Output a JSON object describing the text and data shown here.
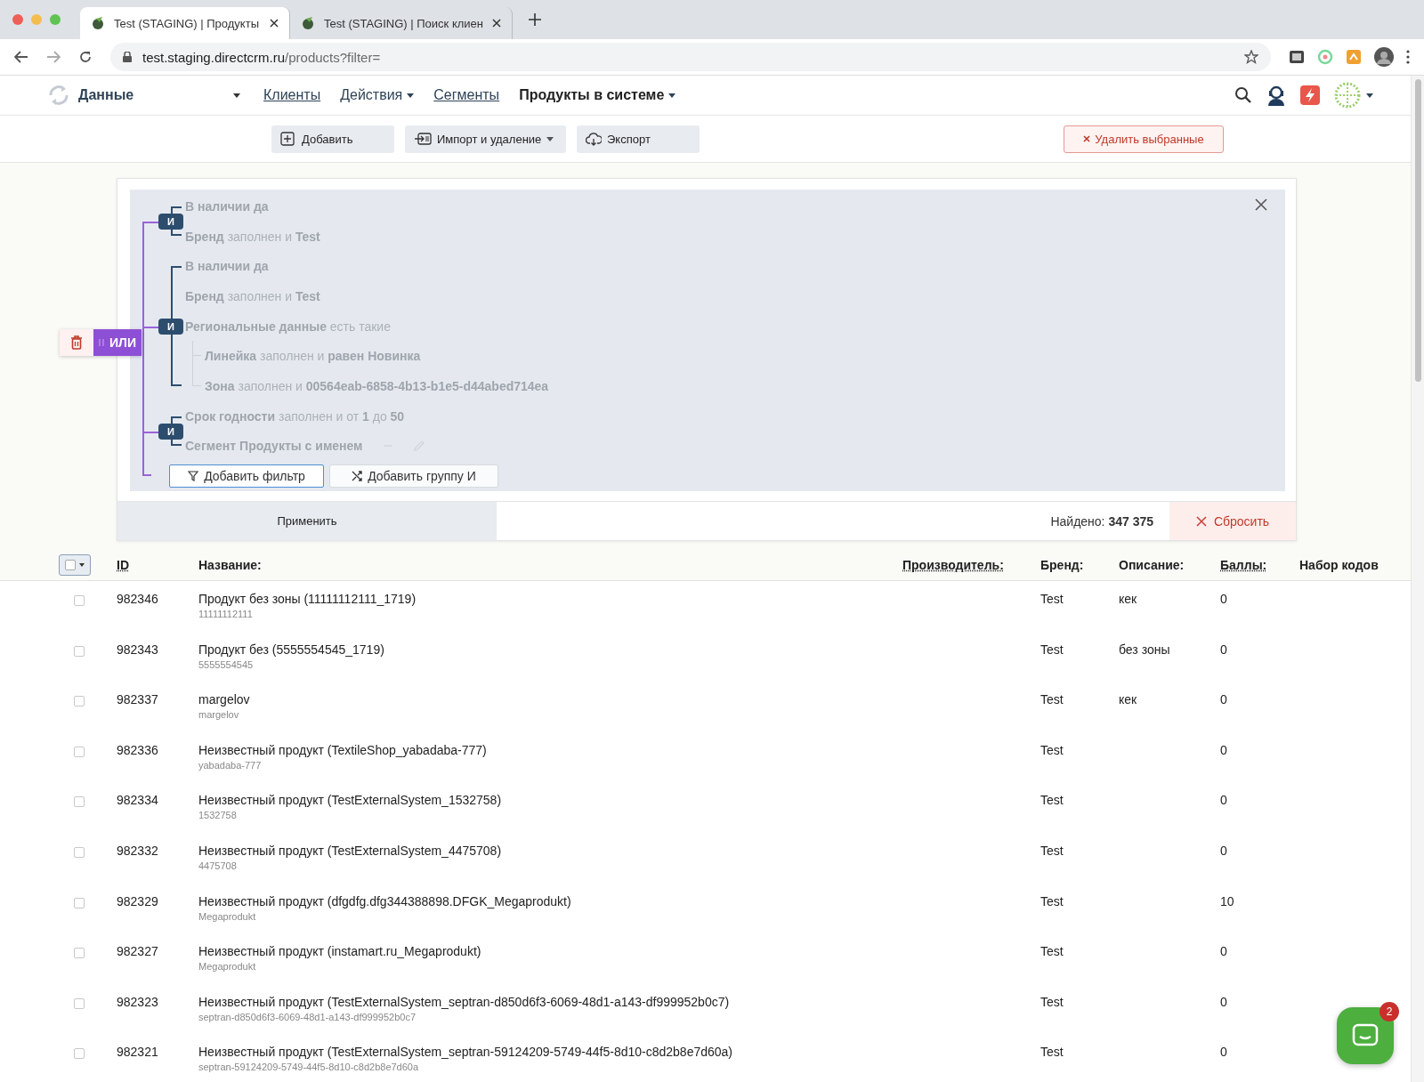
{
  "browser": {
    "tabs": [
      {
        "title": "Test (STAGING) | Продукты",
        "selected": true
      },
      {
        "title": "Test (STAGING) | Поиск клиен",
        "selected": false
      }
    ],
    "address": {
      "host": "test.staging.directcrm.ru",
      "path": "/products?filter="
    }
  },
  "app_header": {
    "section": "Данные",
    "nav": [
      {
        "label": "Клиенты",
        "kind": "link",
        "selected": false
      },
      {
        "label": "Действия",
        "kind": "dropdown",
        "selected": false
      },
      {
        "label": "Сегменты",
        "kind": "link",
        "selected": false
      },
      {
        "label": "Продукты в системе",
        "kind": "dropdown",
        "selected": true
      }
    ]
  },
  "toolbar": {
    "buttons": [
      {
        "label": "Добавить",
        "kind": "add"
      },
      {
        "label": "Импорт и удаление",
        "kind": "import"
      },
      {
        "label": "Экспорт",
        "kind": "export"
      }
    ],
    "delete_button": "Удалить выбранные"
  },
  "filter": {
    "or_label": "ИЛИ",
    "groups": [
      {
        "label": "И",
        "conditions": [
          {
            "text": "**В наличии да**"
          },
          {
            "text": "**Бренд** заполнен и **Test**"
          }
        ]
      },
      {
        "label": "И",
        "conditions": [
          {
            "text": "**В наличии да**"
          },
          {
            "text": "**Бренд** заполнен и **Test**"
          },
          {
            "text": "**Региональные данные** есть такие",
            "children": [
              {
                "text": "**Линейка** заполнен и **равен Новинка**"
              },
              {
                "text": "**Зона** заполнен и **00564eab-6858-4b13-b1e5-d44abed714ea**"
              }
            ]
          }
        ]
      },
      {
        "label": "И",
        "conditions": [
          {
            "text": "**Срок годности** заполнен и от **1** до **50**"
          },
          {
            "text": "**Сегмент Продукты с именем**",
            "kind": "segment"
          }
        ]
      }
    ],
    "add_filter": "Добавить фильтр",
    "add_group": "Добавить группу И",
    "apply": "Применить",
    "found": "Найдено: **347 375**",
    "reset": "Сбросить"
  },
  "table": {
    "select_all_checked": false,
    "columns": [
      {
        "label": "ID",
        "underlined": true
      },
      {
        "label": "Название:",
        "underlined": false
      },
      {
        "label": "Производитель:",
        "underlined": true
      },
      {
        "label": "Бренд:",
        "underlined": false
      },
      {
        "label": "Описание:",
        "underlined": false
      },
      {
        "label": "Баллы:",
        "underlined": true
      },
      {
        "label": "Набор кодов",
        "underlined": false
      }
    ],
    "rows": [
      {
        "id": "982346",
        "name": "Продукт без зоны (11111112111_1719)",
        "code": "11111112111",
        "brand": "Test",
        "description": "кек",
        "points": "0",
        "checked": false
      },
      {
        "id": "982343",
        "name": "Продукт без (5555554545_1719)",
        "code": "5555554545",
        "brand": "Test",
        "description": "без зоны",
        "points": "0",
        "checked": false
      },
      {
        "id": "982337",
        "name": "margelov",
        "code": "margelov",
        "brand": "Test",
        "description": "кек",
        "points": "0",
        "checked": false
      },
      {
        "id": "982336",
        "name": "Неизвестный продукт (TextileShop_yabadaba-777)",
        "code": "yabadaba-777",
        "brand": "Test",
        "points": "0",
        "checked": false
      },
      {
        "id": "982334",
        "name": "Неизвестный продукт (TestExternalSystem_1532758)",
        "code": "1532758",
        "brand": "Test",
        "points": "0",
        "checked": false
      },
      {
        "id": "982332",
        "name": "Неизвестный продукт (TestExternalSystem_4475708)",
        "code": "4475708",
        "brand": "Test",
        "points": "0",
        "checked": false
      },
      {
        "id": "982329",
        "name": "Неизвестный продукт (dfgdfg.dfg344388898.DFGK_Megaprodukt)",
        "code": "Megaprodukt",
        "brand": "Test",
        "points": "10",
        "checked": false
      },
      {
        "id": "982327",
        "name": "Неизвестный продукт (instamart.ru_Megaprodukt)",
        "code": "Megaprodukt",
        "brand": "Test",
        "points": "0",
        "checked": false
      },
      {
        "id": "982323",
        "name": "Неизвестный продукт (TestExternalSystem_septran-d850d6f3-6069-48d1-a143-df999952b0c7)",
        "code": "septran-d850d6f3-6069-48d1-a143-df999952b0c7",
        "brand": "Test",
        "points": "0",
        "checked": false
      },
      {
        "id": "982321",
        "name": "Неизвестный продукт (TestExternalSystem_septran-59124209-5749-44f5-8d10-c8d2b8e7d60a)",
        "code": "septran-59124209-5749-44f5-8d10-c8d2b8e7d60a",
        "brand": "Test",
        "points": "0",
        "checked": false
      }
    ]
  },
  "chat": {
    "badge": "2"
  }
}
